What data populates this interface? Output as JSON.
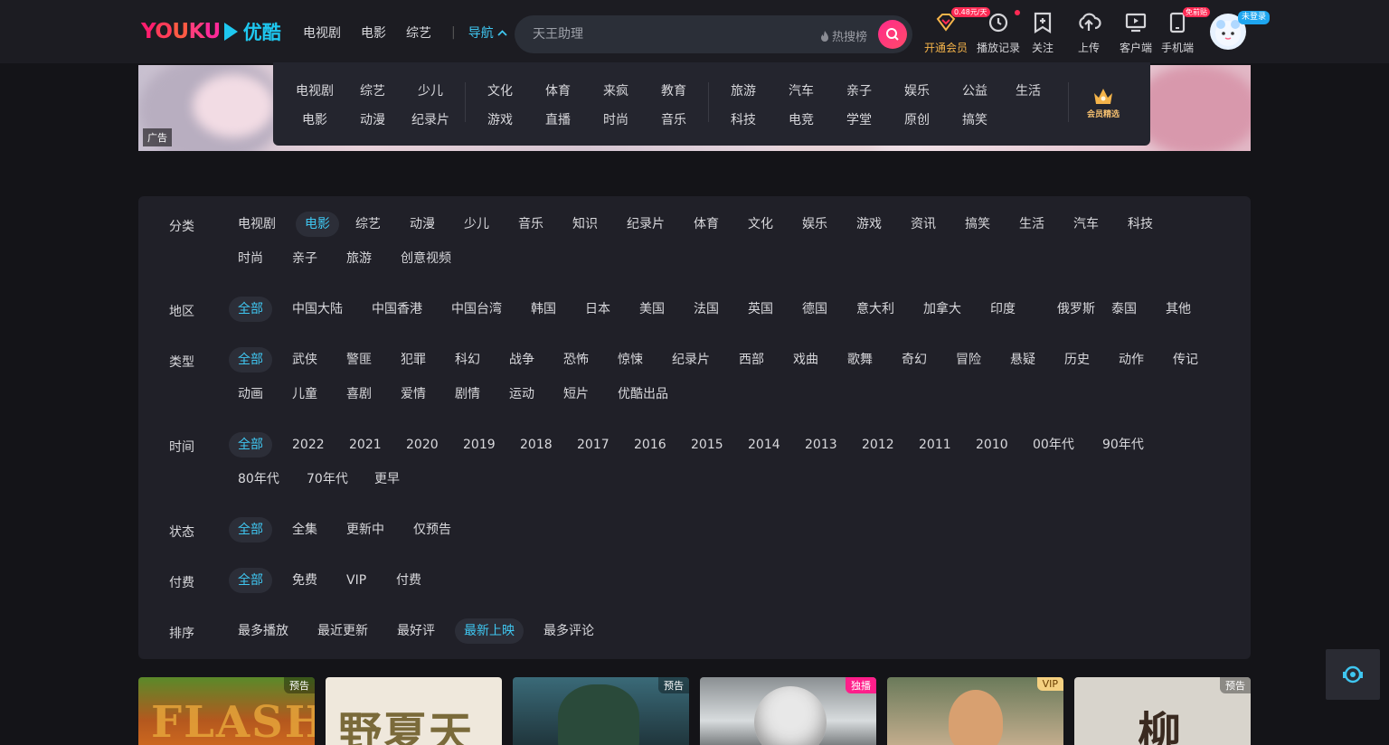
{
  "header": {
    "logo_en": "YOUKU",
    "logo_cn": "优酷",
    "nav": [
      "电视剧",
      "电影",
      "综艺"
    ],
    "nav_active": "导航",
    "search_placeholder": "天王助理",
    "hot_label": "热搜榜",
    "tools": [
      {
        "label": "开通会员",
        "icon": "vip-diamond-icon",
        "pill": "0.48元/天"
      },
      {
        "label": "播放记录",
        "icon": "history-clock-icon"
      },
      {
        "label": "关注",
        "icon": "follow-bookmark-icon"
      },
      {
        "label": "上传",
        "icon": "upload-cloud-icon"
      },
      {
        "label": "客户端",
        "icon": "client-tv-icon"
      },
      {
        "label": "手机端",
        "icon": "mobile-icon",
        "pill": "免前贴"
      }
    ],
    "login_tag": "未登录"
  },
  "banner": {
    "ad_label": "广告"
  },
  "navpanel": {
    "group1": [
      [
        "电视剧",
        "综艺",
        "少儿"
      ],
      [
        "电影",
        "动漫",
        "纪录片"
      ]
    ],
    "group2": [
      [
        "文化",
        "体育",
        "来疯",
        "教育"
      ],
      [
        "游戏",
        "直播",
        "时尚",
        "音乐"
      ]
    ],
    "group3": [
      [
        "旅游",
        "汽车",
        "亲子",
        "娱乐",
        "公益",
        "生活"
      ],
      [
        "科技",
        "电竞",
        "学堂",
        "原创",
        "搞笑"
      ]
    ],
    "member_label": "会员精选"
  },
  "filters": {
    "category": {
      "label": "分类",
      "row1": [
        "电视剧",
        "电影",
        "综艺",
        "动漫",
        "少儿",
        "音乐",
        "知识",
        "纪录片",
        "体育",
        "文化",
        "娱乐",
        "游戏",
        "资讯",
        "搞笑",
        "生活",
        "汽车",
        "科技"
      ],
      "row2": [
        "时尚",
        "亲子",
        "旅游",
        "创意视频"
      ],
      "selected": "电影"
    },
    "region": {
      "label": "地区",
      "row1": [
        "全部",
        "中国大陆",
        "中国香港",
        "中国台湾",
        "韩国",
        "日本",
        "美国",
        "法国",
        "英国",
        "德国",
        "意大利",
        "加拿大",
        "印度",
        "俄罗斯",
        "泰国",
        "其他"
      ],
      "selected": "全部"
    },
    "genre": {
      "label": "类型",
      "row1": [
        "全部",
        "武侠",
        "警匪",
        "犯罪",
        "科幻",
        "战争",
        "恐怖",
        "惊悚",
        "纪录片",
        "西部",
        "戏曲",
        "歌舞",
        "奇幻",
        "冒险",
        "悬疑",
        "历史",
        "动作",
        "传记"
      ],
      "row2": [
        "动画",
        "儿童",
        "喜剧",
        "爱情",
        "剧情",
        "运动",
        "短片",
        "优酷出品"
      ],
      "selected": "全部"
    },
    "year": {
      "label": "时间",
      "row1": [
        "全部",
        "2022",
        "2021",
        "2020",
        "2019",
        "2018",
        "2017",
        "2016",
        "2015",
        "2014",
        "2013",
        "2012",
        "2011",
        "2010",
        "00年代",
        "90年代"
      ],
      "row2": [
        "80年代",
        "70年代",
        "更早"
      ],
      "selected": "全部"
    },
    "status": {
      "label": "状态",
      "row1": [
        "全部",
        "全集",
        "更新中",
        "仅预告"
      ],
      "selected": "全部"
    },
    "pay": {
      "label": "付费",
      "row1": [
        "全部",
        "免费",
        "VIP",
        "付费"
      ],
      "selected": "全部"
    },
    "sort": {
      "label": "排序",
      "row1": [
        "最多播放",
        "最近更新",
        "最好评",
        "最新上映",
        "最多评论"
      ],
      "selected": "最新上映"
    }
  },
  "posters": [
    {
      "badge": "预告",
      "badge_type": "plain",
      "title_art": "FLASH",
      "bg": "#c04a20"
    },
    {
      "badge": "",
      "badge_type": "plain",
      "title_art": "野夏天",
      "bg": "#efe8dc"
    },
    {
      "badge": "预告",
      "badge_type": "plain",
      "title_art": "",
      "bg": "#2c4a52"
    },
    {
      "badge": "独播",
      "badge_type": "ex",
      "title_art": "",
      "bg": "#5a5f62"
    },
    {
      "badge": "VIP",
      "badge_type": "vip",
      "title_art": "",
      "bg": "#8a9a7a"
    },
    {
      "badge": "预告",
      "badge_type": "plain",
      "title_art": "柳",
      "bg": "#d8d4cc"
    }
  ],
  "colors": {
    "accent": "#3fc6f0",
    "brand_pink": "#ff1e6e",
    "vip_gold": "#f5b44a"
  }
}
